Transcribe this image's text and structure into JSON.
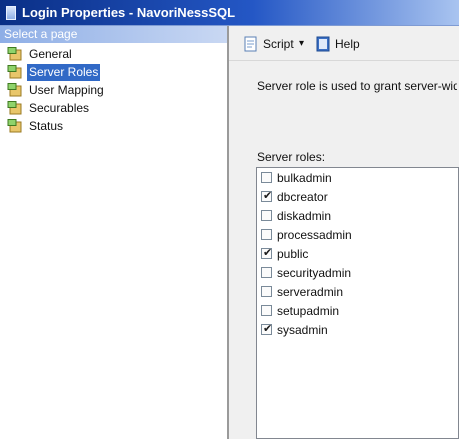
{
  "window": {
    "title": "Login Properties - NavoriNessSQL"
  },
  "left_pane": {
    "header": "Select a page",
    "items": [
      {
        "label": "General",
        "icon": "page-icon",
        "selected": false
      },
      {
        "label": "Server Roles",
        "icon": "page-icon",
        "selected": true
      },
      {
        "label": "User Mapping",
        "icon": "page-icon",
        "selected": false
      },
      {
        "label": "Securables",
        "icon": "page-icon",
        "selected": false
      },
      {
        "label": "Status",
        "icon": "page-icon",
        "selected": false
      }
    ]
  },
  "toolbar": {
    "script_label": "Script",
    "script_dropdown_glyph": "▾",
    "help_label": "Help"
  },
  "main": {
    "description": "Server role is used to grant server-wide security privileges to a user.",
    "roles_label": "Server roles:",
    "roles": [
      {
        "name": "bulkadmin",
        "checked": false
      },
      {
        "name": "dbcreator",
        "checked": true
      },
      {
        "name": "diskadmin",
        "checked": false
      },
      {
        "name": "processadmin",
        "checked": false
      },
      {
        "name": "public",
        "checked": true
      },
      {
        "name": "securityadmin",
        "checked": false
      },
      {
        "name": "serveradmin",
        "checked": false
      },
      {
        "name": "setupadmin",
        "checked": false
      },
      {
        "name": "sysadmin",
        "checked": true
      }
    ]
  },
  "colors": {
    "title_bar": "#0a2f86",
    "selection": "#3169c6",
    "left_header": "#8eaee6"
  }
}
